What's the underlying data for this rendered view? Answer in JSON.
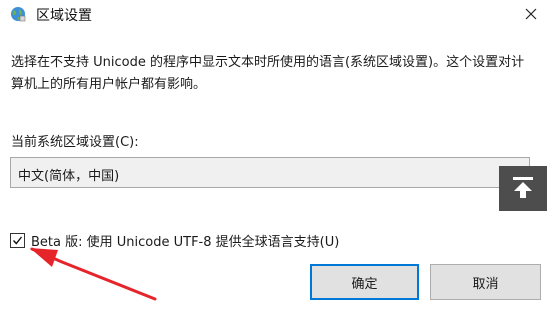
{
  "window": {
    "title": "区域设置",
    "app_icon": "globe-icon",
    "close_icon": "close-icon"
  },
  "description": "选择在不支持 Unicode 的程序中显示文本时所使用的语言(系统区域设置)。这个设置对计算机上的所有用户帐户都有影响。",
  "locale": {
    "label": "当前系统区域设置(C):",
    "selected": "中文(简体，中国)",
    "arrow_icon": "chevron-down-icon"
  },
  "scroll_top_button": {
    "icon": "arrow-up-to-top-icon"
  },
  "beta_option": {
    "label": "Beta 版: 使用 Unicode UTF-8 提供全球语言支持(U)",
    "checked": true
  },
  "buttons": {
    "ok_label": "确定",
    "cancel_label": "取消"
  },
  "colors": {
    "annotation_arrow": "#e6252a",
    "default_button_border": "#0078d7",
    "scroll_top_bg": "#4d4d4d"
  }
}
